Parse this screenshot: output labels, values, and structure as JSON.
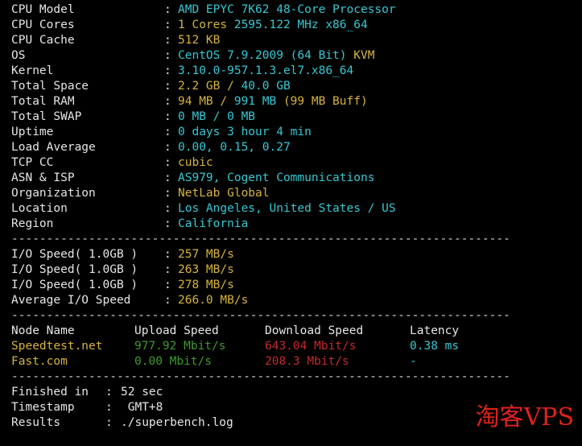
{
  "separator": "--------------------------------------------------------------------------------------",
  "colon": ":",
  "sysinfo": [
    {
      "key": "CPU Model",
      "parts": [
        {
          "t": "AMD EPYC 7K62 48-Core Processor",
          "c": "cyan"
        }
      ]
    },
    {
      "key": "CPU Cores",
      "parts": [
        {
          "t": "1 Cores ",
          "c": "yel"
        },
        {
          "t": "2595.122 MHz x86_64",
          "c": "cyan"
        }
      ]
    },
    {
      "key": "CPU Cache",
      "parts": [
        {
          "t": "512 KB",
          "c": "yel"
        }
      ]
    },
    {
      "key": "OS",
      "parts": [
        {
          "t": "CentOS 7.9.2009 (64 Bit) ",
          "c": "cyan"
        },
        {
          "t": "KVM",
          "c": "yel"
        }
      ]
    },
    {
      "key": "Kernel",
      "parts": [
        {
          "t": "3.10.0-957.1.3.el7.x86_64",
          "c": "cyan"
        }
      ]
    },
    {
      "key": "Total Space",
      "parts": [
        {
          "t": "2.2 GB / ",
          "c": "yel"
        },
        {
          "t": "40.0 GB",
          "c": "cyan"
        }
      ]
    },
    {
      "key": "Total RAM",
      "parts": [
        {
          "t": "94 MB / ",
          "c": "yel"
        },
        {
          "t": "991 MB ",
          "c": "cyan"
        },
        {
          "t": "(99 MB Buff)",
          "c": "yel"
        }
      ]
    },
    {
      "key": "Total SWAP",
      "parts": [
        {
          "t": "0 MB / 0 MB",
          "c": "cyan"
        }
      ]
    },
    {
      "key": "Uptime",
      "parts": [
        {
          "t": "0 days 3 hour 4 min",
          "c": "cyan"
        }
      ]
    },
    {
      "key": "Load Average",
      "parts": [
        {
          "t": "0.00, 0.15, 0.27",
          "c": "cyan"
        }
      ]
    },
    {
      "key": "TCP CC",
      "parts": [
        {
          "t": "cubic",
          "c": "yel"
        }
      ]
    },
    {
      "key": "ASN & ISP",
      "parts": [
        {
          "t": "AS979, Cogent Communications",
          "c": "cyan"
        }
      ]
    },
    {
      "key": "Organization",
      "parts": [
        {
          "t": "NetLab Global",
          "c": "yel"
        }
      ]
    },
    {
      "key": "Location",
      "parts": [
        {
          "t": "Los Angeles, United States / US",
          "c": "cyan"
        }
      ]
    },
    {
      "key": "Region",
      "parts": [
        {
          "t": "California",
          "c": "cyan"
        }
      ]
    }
  ],
  "io": [
    {
      "key": "I/O Speed( 1.0GB )",
      "value": "257 MB/s"
    },
    {
      "key": "I/O Speed( 1.0GB )",
      "value": "263 MB/s"
    },
    {
      "key": "I/O Speed( 1.0GB )",
      "value": "278 MB/s"
    },
    {
      "key": "Average I/O Speed",
      "value": "266.0 MB/s"
    }
  ],
  "speedtest": {
    "headers": [
      "Node Name",
      "Upload Speed",
      "Download Speed",
      "Latency"
    ],
    "rows": [
      {
        "node": "Speedtest.net",
        "up": "977.92 Mbit/s",
        "down": "643.04 Mbit/s",
        "latency": "0.38 ms"
      },
      {
        "node": "Fast.com",
        "up": "0.00 Mbit/s",
        "down": "208.3 Mbit/s",
        "latency": "-"
      }
    ]
  },
  "footer": [
    {
      "key": "Finished in",
      "value": "52 sec"
    },
    {
      "key": "Timestamp",
      "value": " GMT+8"
    },
    {
      "key": "Results",
      "value": "./superbench.log"
    }
  ],
  "watermark": "淘客VPS",
  "colors": {
    "cyan": "#36c8d3",
    "yellow": "#d7b43a",
    "green": "#3f9a2f",
    "red": "#c22b2b"
  }
}
